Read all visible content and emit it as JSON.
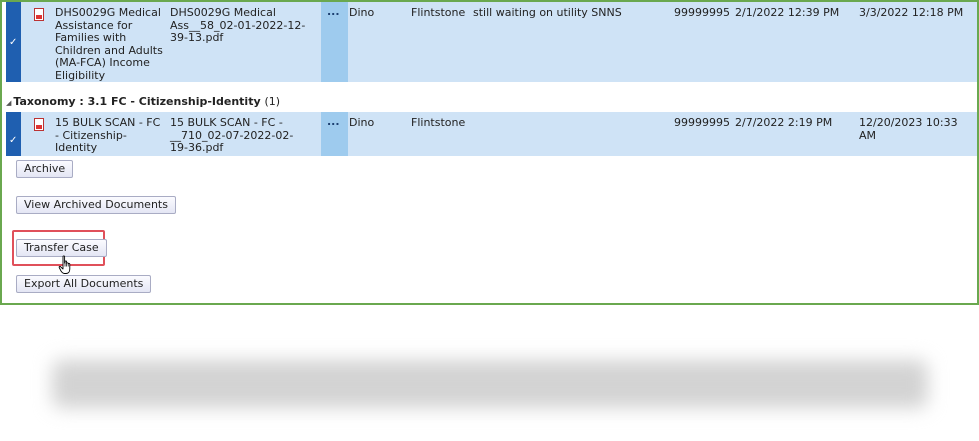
{
  "rows": [
    {
      "check": "✓",
      "title": "DHS0029G Medical\nAssistance for\nFamilies with\nChildren and Adults\n(MA-FCA) Income\nEligibility",
      "filename": "DHS0029G Medical\nAss__58_02-01-2022-12-\n39-13.pdf",
      "menu": "...",
      "first_name": "Dino",
      "last_name": "Flintstone",
      "note": "still waiting on utility SNNS",
      "case_number": "99999995",
      "date1": "2/1/2022 12:39 PM",
      "date2": "3/3/2022 12:18 PM"
    },
    {
      "check": "✓",
      "title": "15 BULK SCAN - FC\n- Citizenship-\nIdentity",
      "filename": "15 BULK SCAN - FC -\n__710_02-07-2022-02-\n19-36.pdf",
      "menu": "...",
      "first_name": "Dino",
      "last_name": "Flintstone",
      "note": "",
      "case_number": "99999995",
      "date1": "2/7/2022 2:19 PM",
      "date2": "12/20/2023 10:33 AM"
    }
  ],
  "group": {
    "label": "Taxonomy : 3.1 FC - Citizenship-Identity",
    "count": "(1)"
  },
  "buttons": {
    "archive": "Archive",
    "view_archived": "View Archived Documents",
    "transfer_case": "Transfer Case",
    "export_all": "Export All Documents"
  },
  "colors": {
    "frame_border": "#6aa84f",
    "row_bg": "#cfe3f6",
    "selected_strip": "#1f5fb0",
    "highlight": "#e0505a"
  }
}
